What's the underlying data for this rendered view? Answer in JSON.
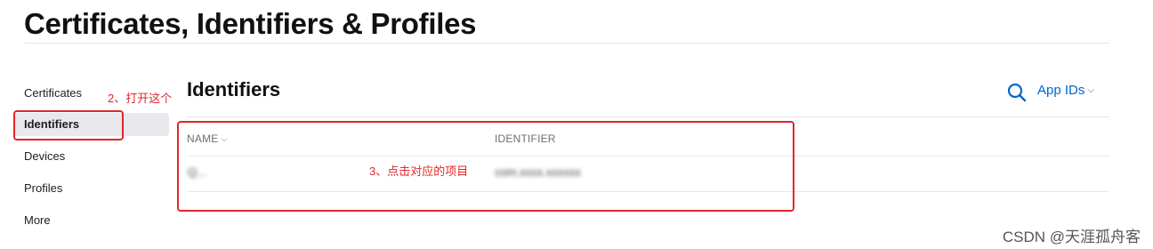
{
  "header": {
    "title": "Certificates, Identifiers & Profiles"
  },
  "sidebar": {
    "items": [
      {
        "label": "Certificates",
        "active": false
      },
      {
        "label": "Identifiers",
        "active": true
      },
      {
        "label": "Devices",
        "active": false
      },
      {
        "label": "Profiles",
        "active": false
      },
      {
        "label": "More",
        "active": false
      }
    ]
  },
  "annotations": {
    "step2": "2、打开这个",
    "step3": "3、点击对应的项目",
    "color": "#e0262b"
  },
  "main": {
    "title": "Identifiers",
    "search_icon": "search-icon",
    "filter_label": "App IDs",
    "columns": [
      {
        "label": "NAME"
      },
      {
        "label": "IDENTIFIER"
      }
    ],
    "rows": [
      {
        "name": "Q...",
        "identifier": "com.xxxx.xxxxxx"
      }
    ]
  },
  "watermark": "CSDN @天涯孤舟客",
  "accent_color": "#0066cc"
}
